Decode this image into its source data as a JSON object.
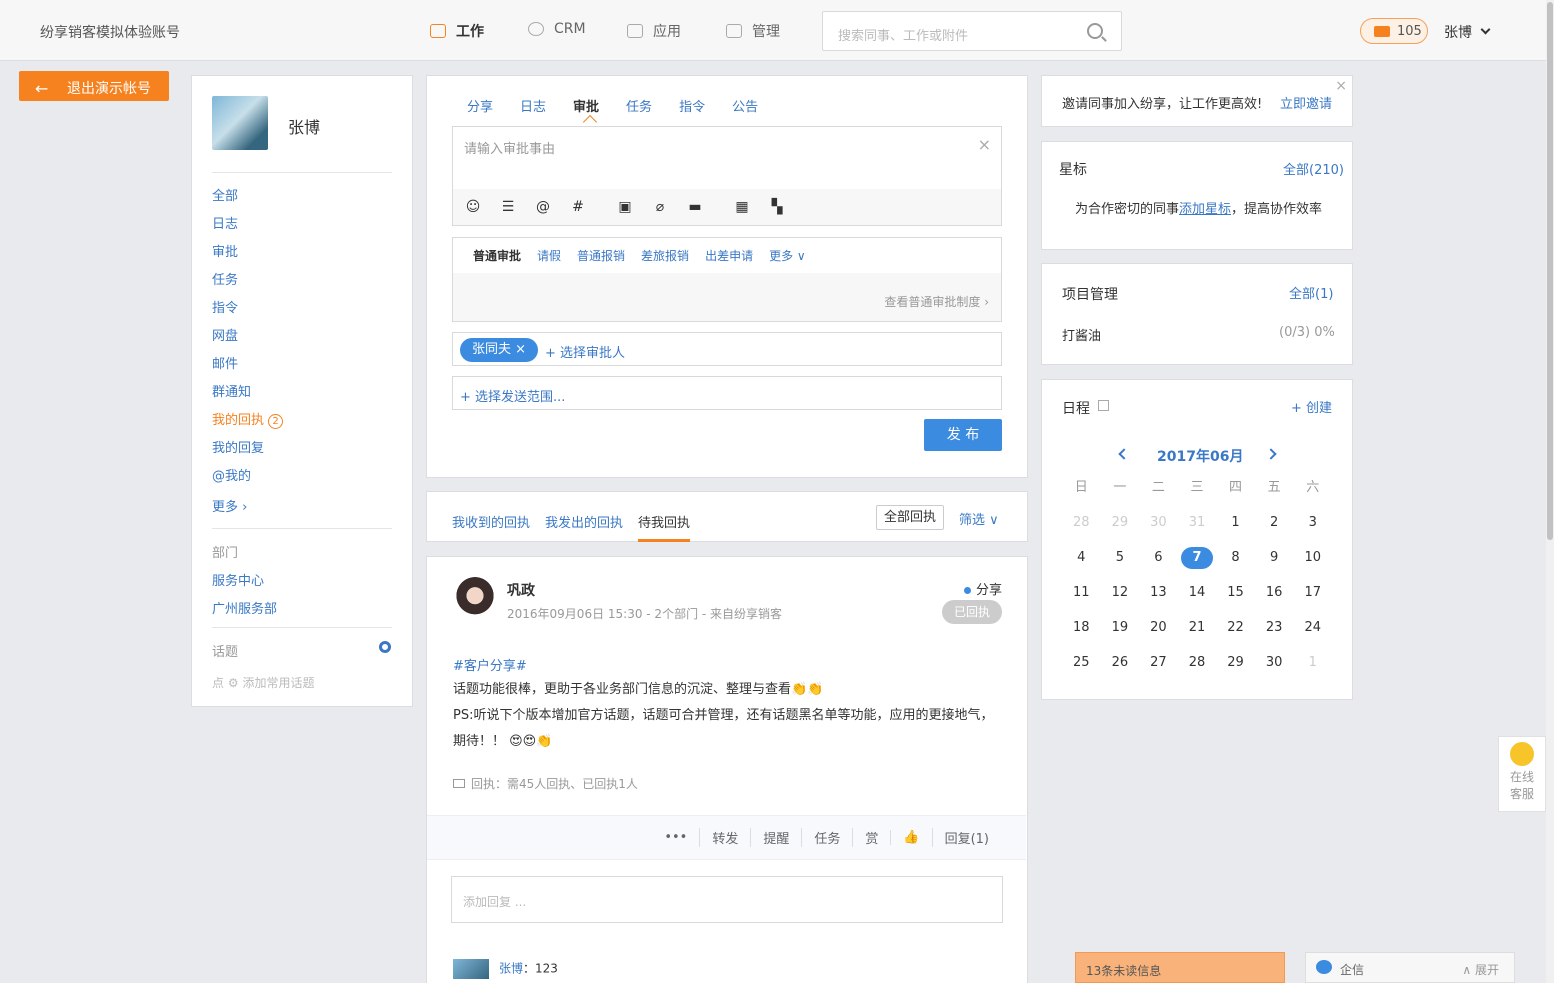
{
  "header": {
    "brand": "纷享销客模拟体验账号",
    "nav": [
      {
        "label": "工作",
        "icon": "work-icon"
      },
      {
        "label": "CRM",
        "icon": "crm-icon"
      },
      {
        "label": "应用",
        "icon": "apps-icon"
      },
      {
        "label": "管理",
        "icon": "manage-icon"
      }
    ],
    "search_placeholder": "搜索同事、工作或附件",
    "mail_count": "105",
    "user_name": "张博"
  },
  "exit_demo": "退出演示帐号",
  "left": {
    "user_name": "张博",
    "menu": [
      "全部",
      "日志",
      "审批",
      "任务",
      "指令",
      "网盘",
      "邮件",
      "群通知"
    ],
    "receipt_label": "我的回执",
    "receipt_count": "2",
    "menu2": [
      "我的回复",
      "@我的",
      "更多 ›"
    ],
    "dept_title": "部门",
    "depts": [
      "服务中心",
      "广州服务部"
    ],
    "topic_title": "话题",
    "topic_add_prefix": "点",
    "topic_add": "添加常用话题"
  },
  "composer": {
    "tabs": [
      "分享",
      "日志",
      "审批",
      "任务",
      "指令",
      "公告"
    ],
    "placeholder": "请输入审批事由",
    "approval_types": [
      "普通审批",
      "请假",
      "普通报销",
      "差旅报销",
      "出差申请",
      "更多"
    ],
    "view_policy": "查看普通审批制度 ›",
    "approver_chip": "张同夫 ×",
    "select_approver": "+ 选择审批人",
    "select_scope": "+ 选择发送范围...",
    "publish": "发 布"
  },
  "receipts": {
    "tabs": [
      "我收到的回执",
      "我发出的回执",
      "待我回执"
    ],
    "all_button": "全部回执",
    "filter": "筛选 ∨"
  },
  "post": {
    "author": "巩政",
    "meta": "2016年09月06日 15:30 - 2个部门 - 来自纷享销客",
    "type": "分享",
    "status": "已回执",
    "tag": "#客户分享#",
    "line1": "话题功能很棒，更助于各业务部门信息的沉淀、整理与查看👏👏",
    "line2": "PS:听说下个版本增加官方话题，话题可合并管理，还有话题黑名单等功能，应用的更接地气，期待！！ 😍😍👏",
    "receipt_info": "回执：需45人回执、已回执1人",
    "actions": [
      "•••",
      "转发",
      "提醒",
      "任务",
      "赏",
      "👍",
      "回复(1)"
    ],
    "reply_placeholder": "添加回复 ...",
    "comment_user": "张博",
    "comment_text": "：123"
  },
  "right": {
    "invite_text": "邀请同事加入纷享，让工作更高效!",
    "invite_link": "立即邀请",
    "star_title": "星标",
    "star_all": "全部(210)",
    "star_tip_a": "为合作密切的同事",
    "star_tip_link": "添加星标",
    "star_tip_b": "，提高协作效率",
    "project_title": "项目管理",
    "project_all": "全部(1)",
    "project_name": "打酱油",
    "project_progress": "(0/3) 0%",
    "schedule_title": "日程",
    "schedule_create": "+ 创建",
    "month": "2017年06月",
    "weekdays": [
      "日",
      "一",
      "二",
      "三",
      "四",
      "五",
      "六"
    ],
    "days": [
      "28",
      "29",
      "30",
      "31",
      "1",
      "2",
      "3",
      "4",
      "5",
      "6",
      "7",
      "8",
      "9",
      "10",
      "11",
      "12",
      "13",
      "14",
      "15",
      "16",
      "17",
      "18",
      "19",
      "20",
      "21",
      "22",
      "23",
      "24",
      "25",
      "26",
      "27",
      "28",
      "29",
      "30",
      "1"
    ],
    "today": "7"
  },
  "kefu": "在线客服",
  "unread": "13条未读信息",
  "qixin": {
    "label": "企信",
    "expand": "∧ 展开"
  }
}
